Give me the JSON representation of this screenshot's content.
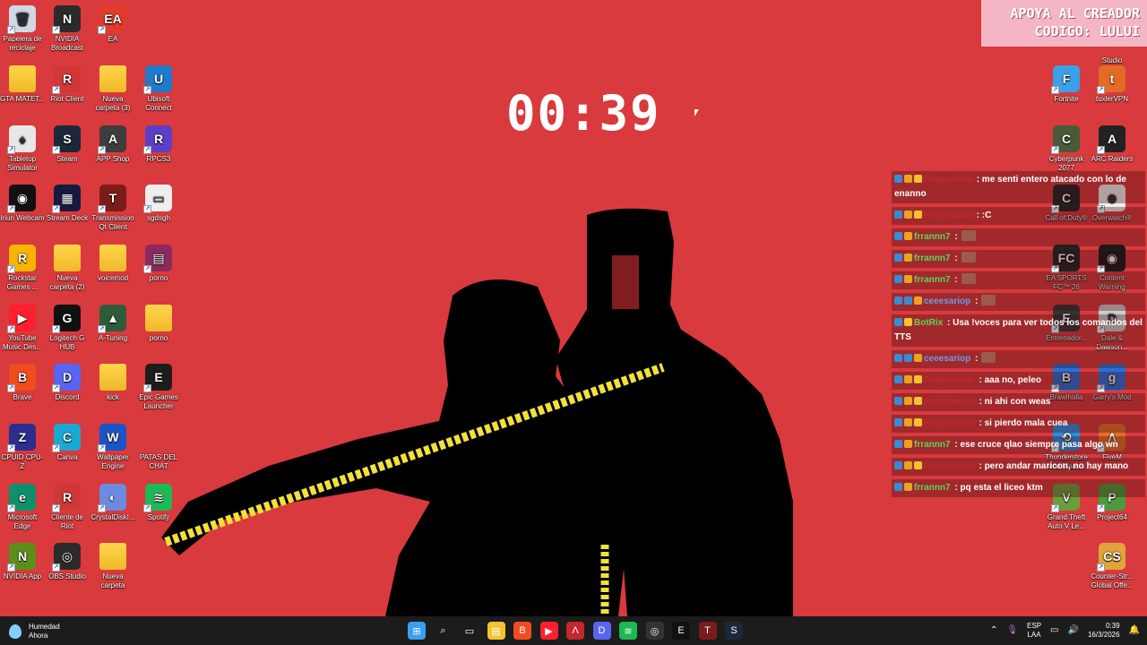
{
  "desktop": {
    "icons": [
      {
        "label": "Papelera de reciclaje",
        "color": "#cfd8e3",
        "glyph": "🗑"
      },
      {
        "label": "NVIDIA Broadcast",
        "color": "#2b2b2b",
        "glyph": "N"
      },
      {
        "label": "EA",
        "color": "#e23b2a",
        "glyph": "EA"
      },
      {
        "label": "GTA MATET...",
        "color": "folder",
        "glyph": ""
      },
      {
        "label": "Riot Client",
        "color": "#d13639",
        "glyph": "R"
      },
      {
        "label": "Nueva carpeta (3)",
        "color": "folder",
        "glyph": ""
      },
      {
        "label": "Ubisoft Connect",
        "color": "#1f7acb",
        "glyph": "U"
      },
      {
        "label": "Tabletop Simulator",
        "color": "#e7e7e7",
        "glyph": "♠"
      },
      {
        "label": "Steam",
        "color": "#1b2838",
        "glyph": "S"
      },
      {
        "label": "APP Shop",
        "color": "#3d3d3d",
        "glyph": "A"
      },
      {
        "label": "RPCS3",
        "color": "#5b40c7",
        "glyph": "R"
      },
      {
        "label": "Iriun Webcam",
        "color": "#111",
        "glyph": "◉"
      },
      {
        "label": "Stream Deck",
        "color": "#161a40",
        "glyph": "▦"
      },
      {
        "label": "Transmission Qt Client",
        "color": "#7a1c1c",
        "glyph": "T"
      },
      {
        "label": "sgdsgh",
        "color": "#eee",
        "glyph": "▭"
      },
      {
        "label": "Rockstar Games ...",
        "color": "#f7b400",
        "glyph": "R"
      },
      {
        "label": "Nueva carpeta (2)",
        "color": "folder",
        "glyph": ""
      },
      {
        "label": "voicemod",
        "color": "folder",
        "glyph": ""
      },
      {
        "label": "porno",
        "color": "#8a2a5e",
        "glyph": "▤"
      },
      {
        "label": "YouTube Music Des...",
        "color": "#ff1f2e",
        "glyph": "▶"
      },
      {
        "label": "Logitech G HUB",
        "color": "#111",
        "glyph": "G"
      },
      {
        "label": "A-Tuning",
        "color": "#2e5c3a",
        "glyph": "▲"
      },
      {
        "label": "porno",
        "color": "folder",
        "glyph": ""
      },
      {
        "label": "Brave",
        "color": "#f04c1f",
        "glyph": "B"
      },
      {
        "label": "Discord",
        "color": "#5865f2",
        "glyph": "D"
      },
      {
        "label": "kick",
        "color": "folder",
        "glyph": ""
      },
      {
        "label": "Epic Games Launcher",
        "color": "#1d1d1d",
        "glyph": "E"
      },
      {
        "label": "CPUID CPU-Z",
        "color": "#2d2d8f",
        "glyph": "Z"
      },
      {
        "label": "Canva",
        "color": "#19a9d3",
        "glyph": "C"
      },
      {
        "label": "Wallpaper Engine",
        "color": "#1b54c9",
        "glyph": "W"
      },
      {
        "label": "PATAS DEL CHAT",
        "color": "none",
        "glyph": ""
      },
      {
        "label": "Microsoft Edge",
        "color": "#0f8f6c",
        "glyph": "e"
      },
      {
        "label": "Cliente de Riot",
        "color": "#d13639",
        "glyph": "R"
      },
      {
        "label": "CrystalDiskI...",
        "color": "#6c8ae0",
        "glyph": "◐"
      },
      {
        "label": "Spotify",
        "color": "#1db954",
        "glyph": "≋"
      },
      {
        "label": "NVIDIA App",
        "color": "#5c8f1a",
        "glyph": "N"
      },
      {
        "label": "OBS Studio",
        "color": "#2b2b2b",
        "glyph": "◎"
      },
      {
        "label": "Nueva carpeta",
        "color": "folder",
        "glyph": ""
      },
      {
        "label": "Studio",
        "color": "none",
        "glyph": ""
      },
      {
        "label": "Fortnite",
        "color": "#3aa0e8",
        "glyph": "F"
      },
      {
        "label": "tuxlerVPN",
        "color": "#e46b24",
        "glyph": "t"
      },
      {
        "label": "Cyberpunk 2077",
        "color": "#4b5a3a",
        "glyph": "C"
      },
      {
        "label": "ARC Raiders",
        "color": "#222",
        "glyph": "A"
      },
      {
        "label": "Call of Duty®",
        "color": "#222",
        "glyph": "C"
      },
      {
        "label": "Overwatch®",
        "color": "#f0f0f0",
        "glyph": "⊕"
      },
      {
        "label": "EA SPORTS FC™ 26",
        "color": "#222",
        "glyph": "FC"
      },
      {
        "label": "Content Warning",
        "color": "#1a1a1a",
        "glyph": "◉"
      },
      {
        "label": "Entrenador...",
        "color": "#333",
        "glyph": "E"
      },
      {
        "label": "Dale & Dawson...",
        "color": "#ccc",
        "glyph": "D"
      },
      {
        "label": "Brawlhalla",
        "color": "#2a6ed2",
        "glyph": "B"
      },
      {
        "label": "Garry's Mod",
        "color": "#2b6fd7",
        "glyph": "g"
      },
      {
        "label": "Thunderstore Mod Mana...",
        "color": "#2b8ee0",
        "glyph": "⟲"
      },
      {
        "label": "FiveM",
        "color": "#e56e27",
        "glyph": "Λ"
      },
      {
        "label": "Grand Theft Auto V Le...",
        "color": "#6a9e3a",
        "glyph": "V"
      },
      {
        "label": "Project64",
        "color": "#4a9c3b",
        "glyph": "P"
      },
      {
        "label": "Counter-Str... Global Offe...",
        "color": "#e0a43a",
        "glyph": "CS"
      }
    ]
  },
  "timer": {
    "value": "00:39"
  },
  "banner": {
    "line1": "APOYA AL CREADOR",
    "line2": "CODIGO: LULUI"
  },
  "chat": {
    "messages": [
      {
        "user": "Pagenaindo",
        "user_color": "#c4262e",
        "text": ": me senti entero atacado con lo de enanno",
        "badges": [
          "b1",
          "b2",
          "b3"
        ]
      },
      {
        "user": "Pagenaindo",
        "user_color": "#c4262e",
        "text": ": :C",
        "badges": [
          "b1",
          "b2",
          "b3"
        ]
      },
      {
        "user": "frrannn7",
        "user_color": "#5fd35a",
        "text": " :",
        "badges": [
          "b1",
          "b2"
        ],
        "emote": true
      },
      {
        "user": "frrannn7",
        "user_color": "#5fd35a",
        "text": " :",
        "badges": [
          "b1",
          "b2"
        ],
        "emote": true
      },
      {
        "user": "frrannn7",
        "user_color": "#5fd35a",
        "text": " :",
        "badges": [
          "b1",
          "b2"
        ],
        "emote": true
      },
      {
        "user": "ceeesariop",
        "user_color": "#6b9ce8",
        "text": " :",
        "badges": [
          "b1",
          "b1",
          "b2"
        ],
        "emote": true
      },
      {
        "user": "BotRix",
        "user_color": "#5fd35a",
        "text": " : Usa !voces para ver todos los comandos del TTS",
        "badges": [
          "b1",
          "b3"
        ]
      },
      {
        "user": "ceeesariop",
        "user_color": "#6b9ce8",
        "text": " :",
        "badges": [
          "b1",
          "b1",
          "b2"
        ],
        "emote": true
      },
      {
        "user": "Pagenaindo",
        "user_color": "#c4262e",
        "text": " : aaa no, peleo",
        "badges": [
          "b1",
          "b2",
          "b3"
        ]
      },
      {
        "user": "Pagenaindo",
        "user_color": "#c4262e",
        "text": " : ni ahi con weas",
        "badges": [
          "b1",
          "b2",
          "b3"
        ]
      },
      {
        "user": "Pagenaindo",
        "user_color": "#c4262e",
        "text": " : si pierdo mala cuea",
        "badges": [
          "b1",
          "b2",
          "b3"
        ]
      },
      {
        "user": "frrannn7",
        "user_color": "#5fd35a",
        "text": " : ese cruce qlao siempre pasa algo wn",
        "badges": [
          "b1",
          "b2"
        ]
      },
      {
        "user": "Pagenaindo",
        "user_color": "#c4262e",
        "text": " : pero andar maricon, no hay mano",
        "badges": [
          "b1",
          "b2",
          "b3"
        ]
      },
      {
        "user": "frrannn7",
        "user_color": "#5fd35a",
        "text": " : pq esta el liceo ktm",
        "badges": [
          "b1",
          "b2"
        ]
      }
    ]
  },
  "taskbar": {
    "weather_title": "Humedad",
    "weather_sub": "Ahora",
    "lang1": "ESP",
    "lang2": "LAA",
    "time": "0:39",
    "date": "16/3/2026",
    "apps": [
      {
        "name": "start",
        "color": "#3aa0f0",
        "glyph": "⊞"
      },
      {
        "name": "search",
        "color": "none",
        "glyph": "⌕"
      },
      {
        "name": "task-view",
        "color": "none",
        "glyph": "▭"
      },
      {
        "name": "file-explorer",
        "color": "#f2c230",
        "glyph": "▤"
      },
      {
        "name": "brave",
        "color": "#f04c1f",
        "glyph": "B"
      },
      {
        "name": "youtube-music",
        "color": "#ff1f2e",
        "glyph": "▶"
      },
      {
        "name": "app-a",
        "color": "#c4262e",
        "glyph": "Λ"
      },
      {
        "name": "discord",
        "color": "#5865f2",
        "glyph": "D"
      },
      {
        "name": "spotify",
        "color": "#1db954",
        "glyph": "≋"
      },
      {
        "name": "obs",
        "color": "#333",
        "glyph": "◎"
      },
      {
        "name": "epic",
        "color": "#111",
        "glyph": "E"
      },
      {
        "name": "transmission",
        "color": "#7a1c1c",
        "glyph": "T"
      },
      {
        "name": "steam",
        "color": "#1b2838",
        "glyph": "S"
      }
    ]
  }
}
